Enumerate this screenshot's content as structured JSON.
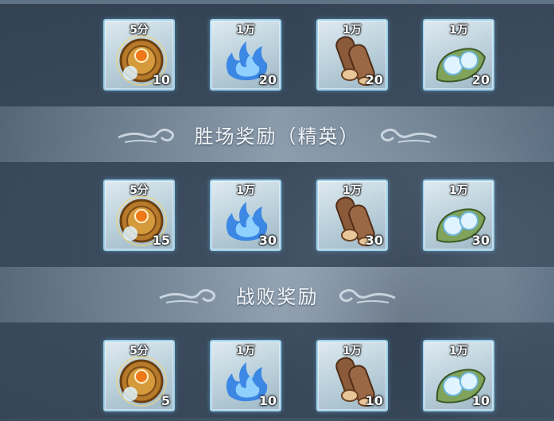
{
  "sections": [
    {
      "title": "",
      "items": [
        {
          "icon": "bronze-medallion-icon",
          "badge": "5分",
          "count": "10"
        },
        {
          "icon": "blue-flame-icon",
          "badge": "1万",
          "count": "20"
        },
        {
          "icon": "wood-logs-icon",
          "badge": "1万",
          "count": "20"
        },
        {
          "icon": "water-dewdrop-leaf-icon",
          "badge": "1万",
          "count": "20"
        }
      ]
    },
    {
      "title": "胜场奖励（精英）",
      "items": [
        {
          "icon": "bronze-medallion-icon",
          "badge": "5分",
          "count": "15"
        },
        {
          "icon": "blue-flame-icon",
          "badge": "1万",
          "count": "30"
        },
        {
          "icon": "wood-logs-icon",
          "badge": "1万",
          "count": "30"
        },
        {
          "icon": "water-dewdrop-leaf-icon",
          "badge": "1万",
          "count": "30"
        }
      ]
    },
    {
      "title": "战败奖励",
      "items": [
        {
          "icon": "bronze-medallion-icon",
          "badge": "5分",
          "count": "5"
        },
        {
          "icon": "blue-flame-icon",
          "badge": "1万",
          "count": "10"
        },
        {
          "icon": "wood-logs-icon",
          "badge": "1万",
          "count": "10"
        },
        {
          "icon": "water-dewdrop-leaf-icon",
          "badge": "1万",
          "count": "10"
        }
      ]
    }
  ],
  "colors": {
    "frame_border": "#9fd2ec",
    "header_text": "#f2f5f8"
  }
}
